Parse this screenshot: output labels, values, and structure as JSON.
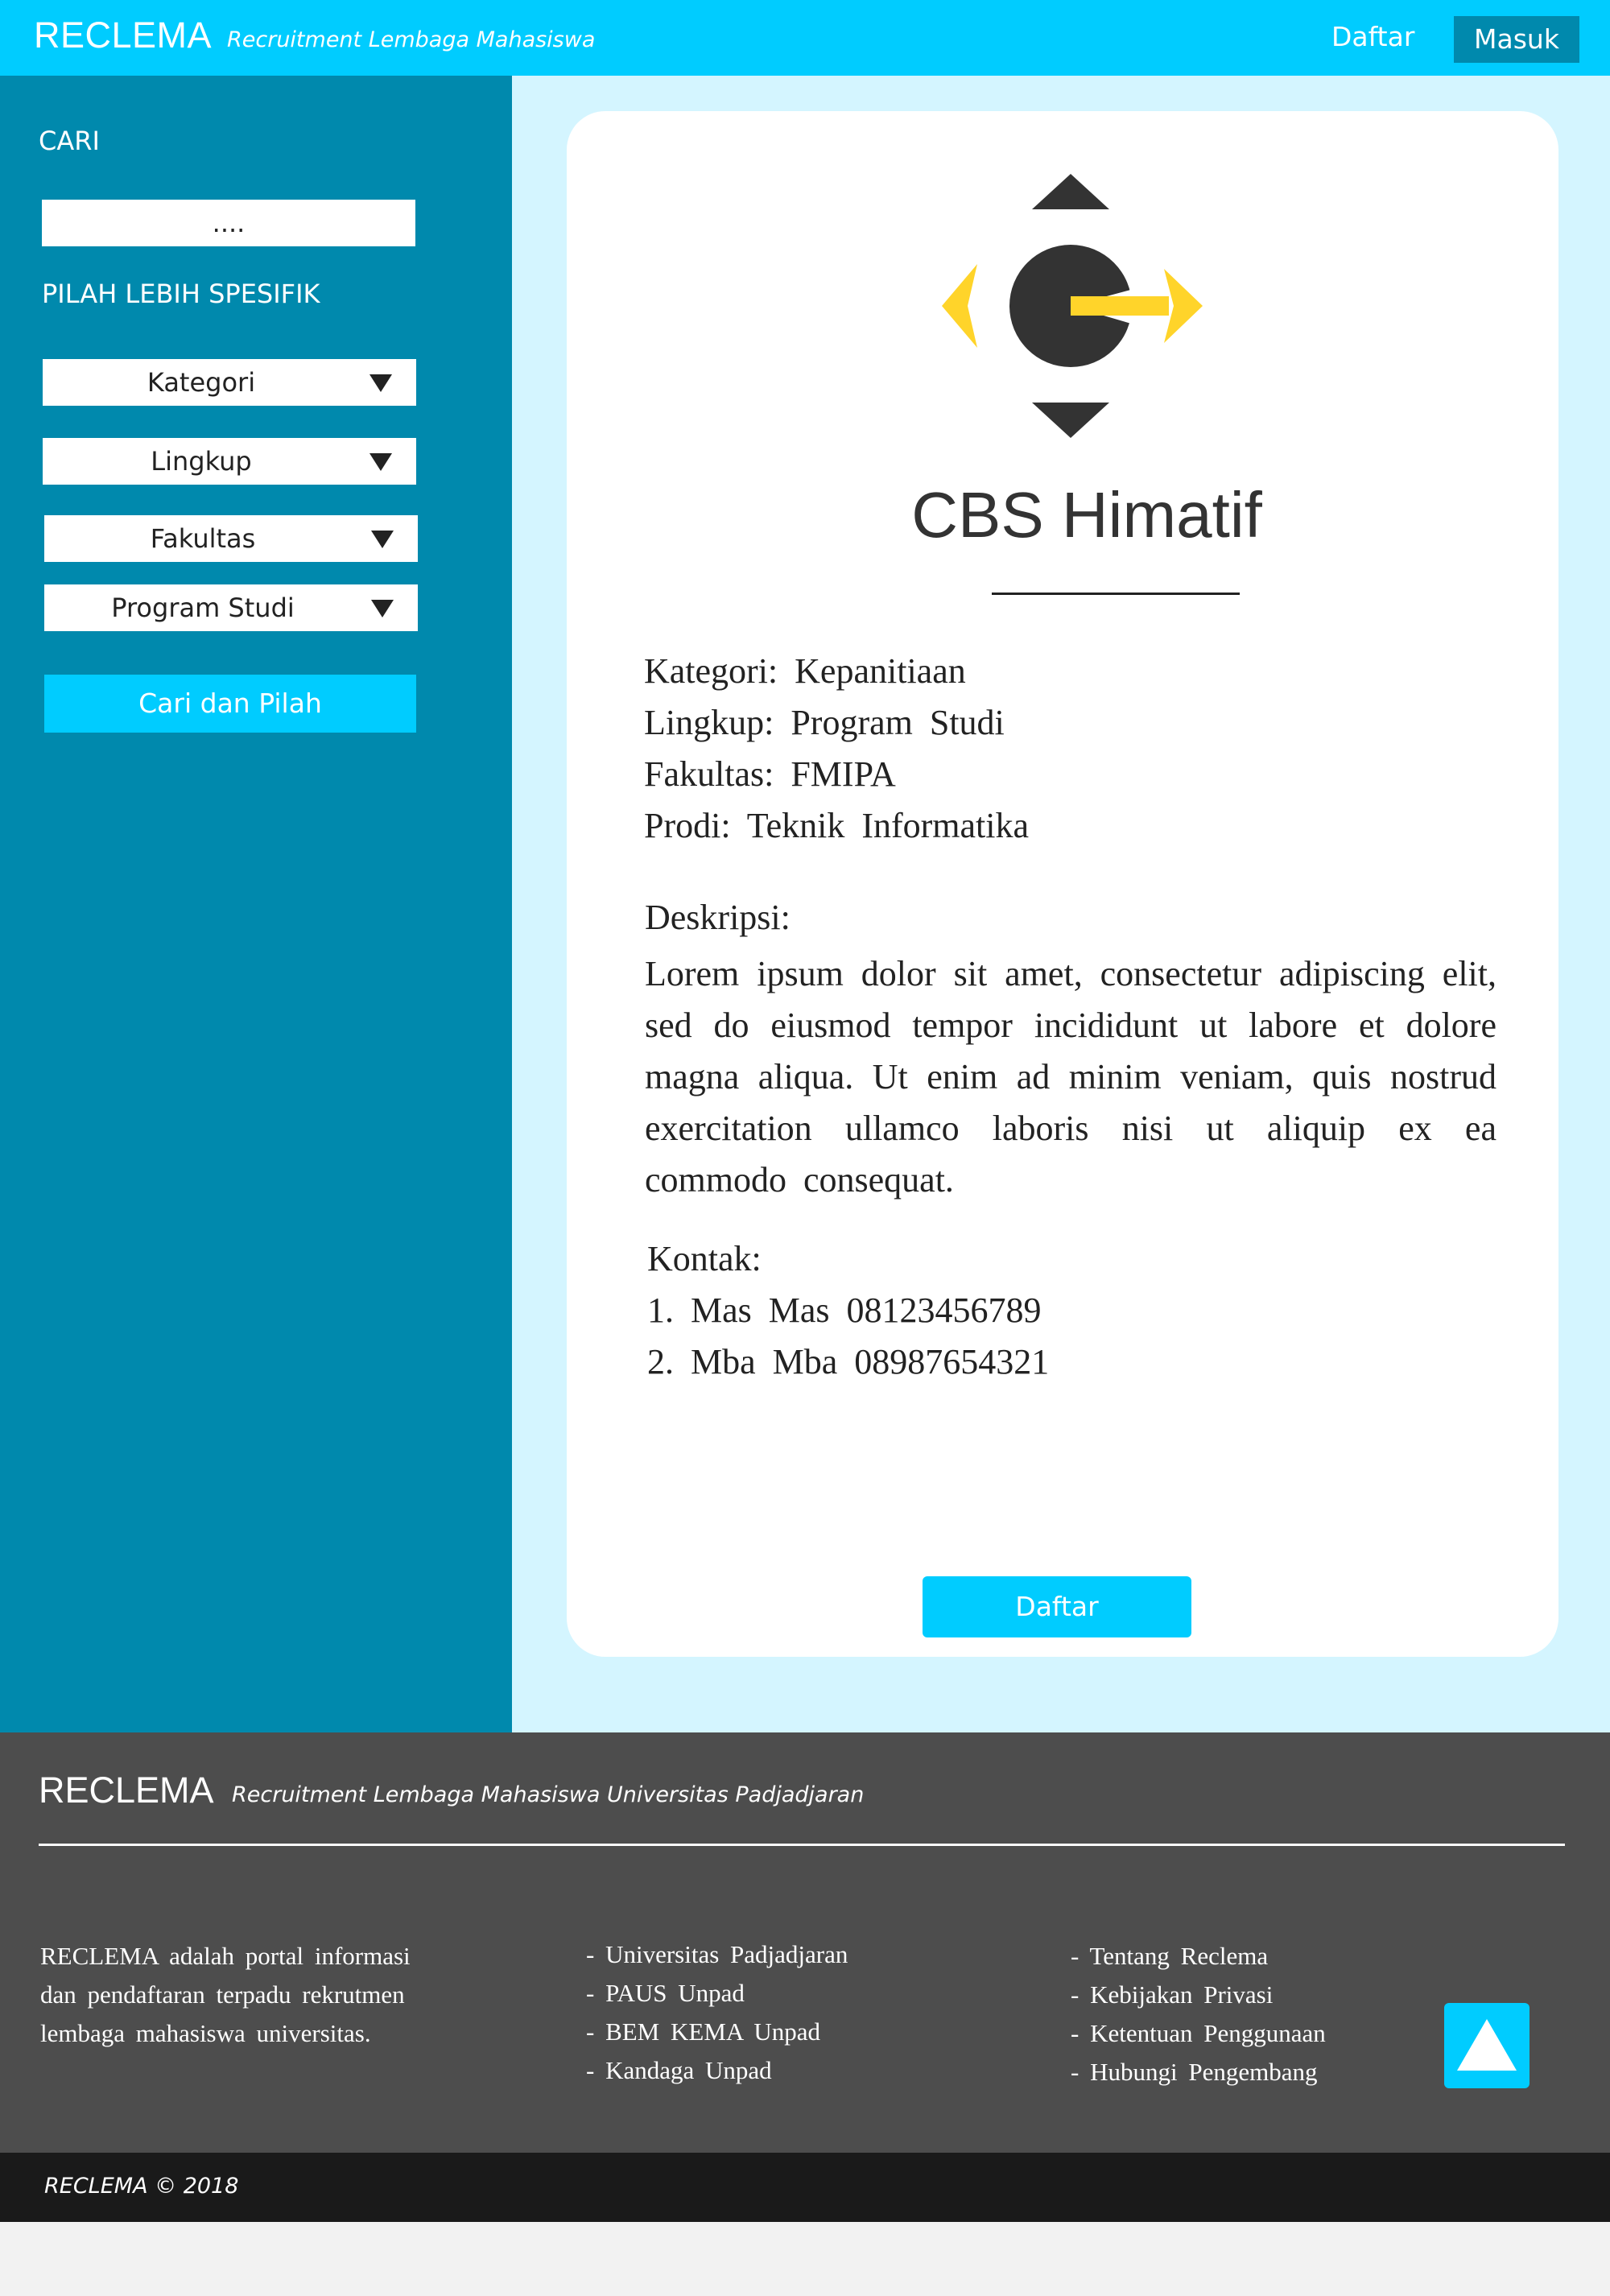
{
  "header": {
    "brand": "RECLEMA",
    "tagline": "Recruitment Lembaga Mahasiswa",
    "nav_daftar": "Daftar",
    "nav_masuk": "Masuk"
  },
  "sidebar": {
    "search_label": "CARI",
    "search_value": "....",
    "filter_label": "PILAH LEBIH SPESIFIK",
    "filters": [
      "Kategori",
      "Lingkup",
      "Fakultas",
      "Program Studi"
    ],
    "submit_label": "Cari dan Pilah"
  },
  "detail": {
    "org_name": "CBS Himatif",
    "meta": [
      "Kategori: Kepanitiaan",
      "Lingkup: Program Studi",
      "Fakultas: FMIPA",
      "Prodi: Teknik Informatika"
    ],
    "description_label": "Deskripsi:",
    "description": "Lorem ipsum dolor sit amet, consectetur adipiscing elit, sed do eiusmod tempor incididunt ut labore et dolore magna aliqua. Ut enim ad minim veniam, quis nostrud exercitation ullamco laboris nisi ut aliquip ex ea commodo consequat.",
    "contact_label": "Kontak:",
    "contacts": [
      "1. Mas Mas 08123456789",
      "2. Mba Mba 08987654321"
    ],
    "register_button": "Daftar"
  },
  "footer": {
    "brand": "RECLEMA",
    "tagline": "Recruitment Lembaga Mahasiswa Universitas Padjadjaran",
    "about_lines": [
      "RECLEMA adalah portal informasi",
      "dan pendaftaran terpadu rekrutmen",
      "lembaga mahasiswa universitas."
    ],
    "links_col1": [
      "- Universitas Padjadjaran",
      "- PAUS Unpad",
      "- BEM KEMA Unpad",
      "- Kandaga Unpad"
    ],
    "links_col2": [
      "- Tentang Reclema",
      "- Kebijakan Privasi",
      "- Ketentuan Penggunaan",
      "- Hubungi Pengembang"
    ],
    "copyright": "RECLEMA © 2018"
  },
  "colors": {
    "primary": "#00ccff",
    "sidebar": "#0089ad",
    "main_bg": "#d4f5ff",
    "footer": "#4d4d4d",
    "bottom_bar": "#1a1a1a",
    "logo_yellow": "#ffd42a",
    "logo_dark": "#333333"
  },
  "icons": {
    "back_to_top": "arrow-up-icon",
    "dropdown": "caret-down-icon"
  }
}
